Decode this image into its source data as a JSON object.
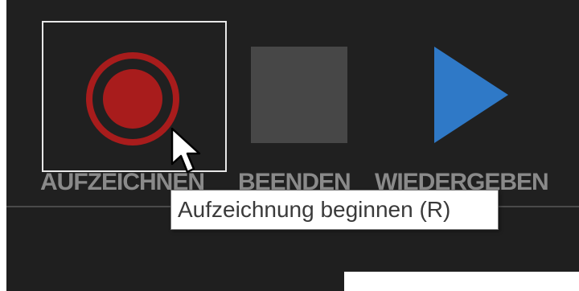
{
  "toolbar": {
    "record": {
      "label": "AUFZEICHNEN",
      "icon": "record-icon",
      "selected": true
    },
    "stop": {
      "label": "BEENDEN",
      "icon": "stop-icon"
    },
    "play": {
      "label": "WIEDERGEBEN",
      "icon": "play-icon"
    }
  },
  "tooltip": {
    "text": "Aufzeichnung beginnen (R)"
  },
  "colors": {
    "background": "#202020",
    "record_red": "#a81c1c",
    "stop_gray": "#474747",
    "play_blue": "#2f79c7",
    "label_gray": "#8a8a8a"
  }
}
